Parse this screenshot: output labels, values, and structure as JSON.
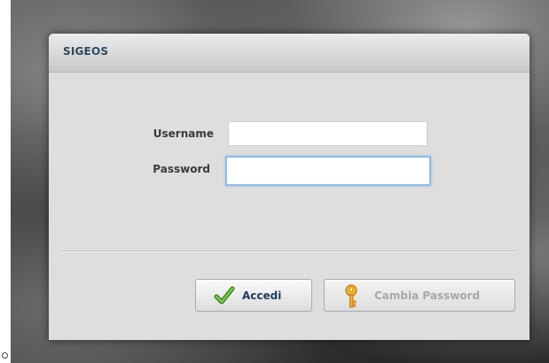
{
  "dialog": {
    "title": "SIGEOS"
  },
  "form": {
    "username_label": "Username",
    "password_label": "Password",
    "username_value": "",
    "password_value": ""
  },
  "buttons": {
    "login_label": "Accedi",
    "login_icon": "checkmark-icon",
    "change_password_label": "Cambia Password",
    "change_password_icon": "key-icon",
    "change_password_enabled": false
  },
  "colors": {
    "title_text": "#2f4a5e",
    "login_text": "#243a5e",
    "disabled_text": "#a8a8a8",
    "focus_border": "#8fbde6",
    "checkmark": "#4a9a2a",
    "key": "#e8a317"
  }
}
